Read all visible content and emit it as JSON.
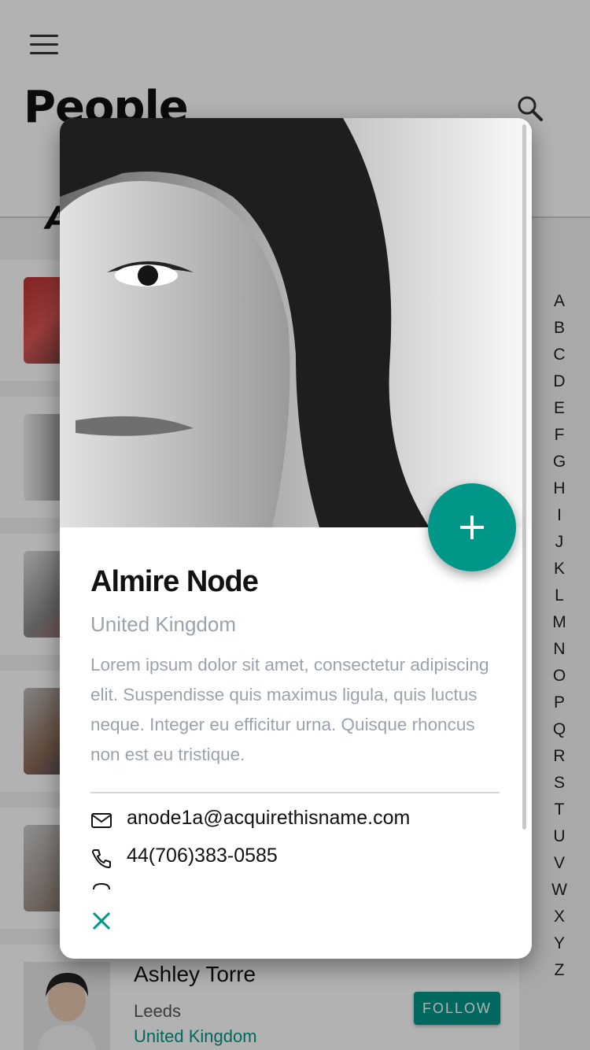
{
  "header": {
    "title": "People"
  },
  "section": {
    "letter": "A"
  },
  "list": {
    "visible_item": {
      "name": "Ashley Torre",
      "city": "Leeds",
      "country": "United Kingdom",
      "follow_label": "FOLLOW"
    }
  },
  "alphabet": [
    "A",
    "B",
    "C",
    "D",
    "E",
    "F",
    "G",
    "H",
    "I",
    "J",
    "K",
    "L",
    "M",
    "N",
    "O",
    "P",
    "Q",
    "R",
    "S",
    "T",
    "U",
    "V",
    "W",
    "X",
    "Y",
    "Z"
  ],
  "card": {
    "name": "Almire Node",
    "country": "United Kingdom",
    "bio": "Lorem ipsum dolor sit amet, consectetur adipiscing elit. Suspendisse quis maximus ligula, quis luctus neque. Integer eu efficitur urna. Quisque rhoncus non est eu tristique.",
    "email": "anode1a@acquirethisname.com",
    "phone": "44(706)383-0585"
  },
  "colors": {
    "accent": "#009688"
  },
  "icons": {
    "menu": "hamburger-icon",
    "search": "search-icon",
    "add": "plus-icon",
    "email": "envelope-icon",
    "phone": "phone-icon",
    "close": "close-icon"
  }
}
